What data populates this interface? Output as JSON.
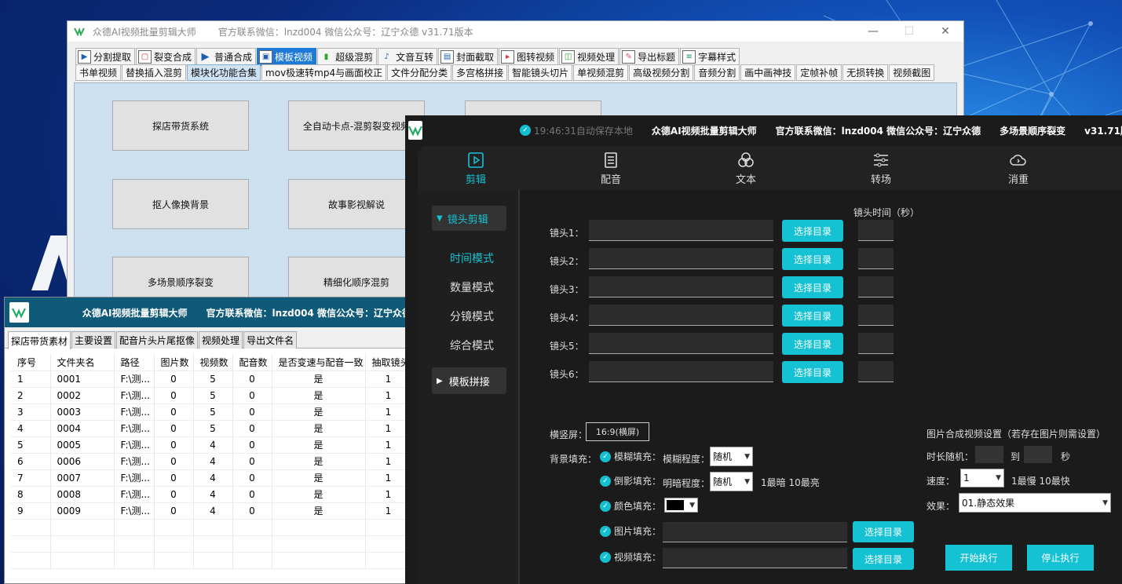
{
  "window1": {
    "title": "众德AI视频批量剪辑大师",
    "contact": "官方联系微信：lnzd004 微信公众号：辽宁众德   v31.71版本",
    "controls": [
      "—",
      "☐",
      "✕"
    ],
    "tabs": [
      {
        "label": "分割提取",
        "icon": "play-icon"
      },
      {
        "label": "裂变合成",
        "icon": "frame-icon"
      },
      {
        "label": "普通合成",
        "icon": "play-icon"
      },
      {
        "label": "模板视频",
        "icon": "template-icon"
      },
      {
        "label": "超级混剪",
        "icon": "wave-icon"
      },
      {
        "label": "文音互转",
        "icon": "audio-icon"
      },
      {
        "label": "封面截取",
        "icon": "image-icon"
      },
      {
        "label": "图转视频",
        "icon": "video-icon"
      },
      {
        "label": "视频处理",
        "icon": "process-icon"
      },
      {
        "label": "导出标题",
        "icon": "export-icon"
      },
      {
        "label": "字幕样式",
        "icon": "subtitle-icon"
      }
    ],
    "subtabs": [
      "书单视频",
      "替换插入混剪",
      "模块化功能合集",
      "mov极速转mp4与画面校正",
      "文件分配分类",
      "多宫格拼接",
      "智能镜头切片",
      "单视频混剪",
      "高级视频分割",
      "音频分割",
      "画中画神技",
      "定帧补帧",
      "无损转换",
      "视频截图"
    ],
    "buttons": [
      "探店带货系统",
      "全自动卡点-混剪裂变视频",
      "",
      "抠人像换背景",
      "故事影视解说",
      "多场景顺序裂变",
      "精细化顺序混剪"
    ]
  },
  "window2": {
    "title": "众德AI视频批量剪辑大师",
    "contact": "官方联系微信：lnzd004 微信公众号：辽宁众德",
    "tabs": [
      "探店带货素材",
      "主要设置",
      "配音片头片尾抠像",
      "视频处理",
      "导出文件名"
    ],
    "columns": [
      "序号",
      "文件夹名",
      "路径",
      "图片数",
      "视频数",
      "配音数",
      "是否变速与配音一致",
      "抽取镜头"
    ],
    "rows": [
      [
        "1",
        "0001",
        "F:\\测...",
        "0",
        "5",
        "0",
        "是",
        "1"
      ],
      [
        "2",
        "0002",
        "F:\\测...",
        "0",
        "5",
        "0",
        "是",
        "1"
      ],
      [
        "3",
        "0003",
        "F:\\测...",
        "0",
        "5",
        "0",
        "是",
        "1"
      ],
      [
        "4",
        "0004",
        "F:\\测...",
        "0",
        "5",
        "0",
        "是",
        "1"
      ],
      [
        "5",
        "0005",
        "F:\\测...",
        "0",
        "4",
        "0",
        "是",
        "1"
      ],
      [
        "6",
        "0006",
        "F:\\测...",
        "0",
        "4",
        "0",
        "是",
        "1"
      ],
      [
        "7",
        "0007",
        "F:\\测...",
        "0",
        "4",
        "0",
        "是",
        "1"
      ],
      [
        "8",
        "0008",
        "F:\\测...",
        "0",
        "4",
        "0",
        "是",
        "1"
      ],
      [
        "9",
        "0009",
        "F:\\测...",
        "0",
        "4",
        "0",
        "是",
        "1"
      ]
    ]
  },
  "window3": {
    "save_status": "19:46:31自动保存本地",
    "title": "众德AI视频批量剪辑大师",
    "contact": "官方联系微信：lnzd004 微信公众号：辽宁众德",
    "mode": "多场景顺序裂变",
    "version": "v31.71版本",
    "nav": [
      "剪辑",
      "配音",
      "文本",
      "转场",
      "消重"
    ],
    "sidebar": {
      "group1": "镜头剪辑",
      "items": [
        "时间模式",
        "数量模式",
        "分镜模式",
        "综合模式"
      ],
      "group2": "模板拼接"
    },
    "shot_time_header": "镜头时间（秒）",
    "shots": [
      "镜头1：",
      "镜头2：",
      "镜头3：",
      "镜头4：",
      "镜头5：",
      "镜头6："
    ],
    "select_dir": "选择目录",
    "orientation_label": "横竖屏：",
    "orientation_value": "16:9(横屏)",
    "bg_fill_label": "背景填充：",
    "blur_fill": "模糊填充：",
    "blur_level_label": "模糊程度：",
    "blur_level_value": "随机",
    "reflect_fill": "倒影填充：",
    "brightness_label": "明暗程度：",
    "brightness_value": "随机",
    "brightness_hint": "1最暗 10最亮",
    "color_fill": "颜色填充：",
    "image_fill": "图片填充：",
    "video_fill": "视频填充：",
    "img_video_title": "图片合成视频设置（若存在图片则需设置）",
    "duration_label": "时长随机：",
    "to": "到",
    "seconds": "秒",
    "speed_label": "速度：",
    "speed_value": "1",
    "speed_hint": "1最慢 10最快",
    "effect_label": "效果：",
    "effect_value": "01.静态效果",
    "start": "开始执行",
    "stop": "停止执行",
    "accent": "#15c2d3"
  }
}
